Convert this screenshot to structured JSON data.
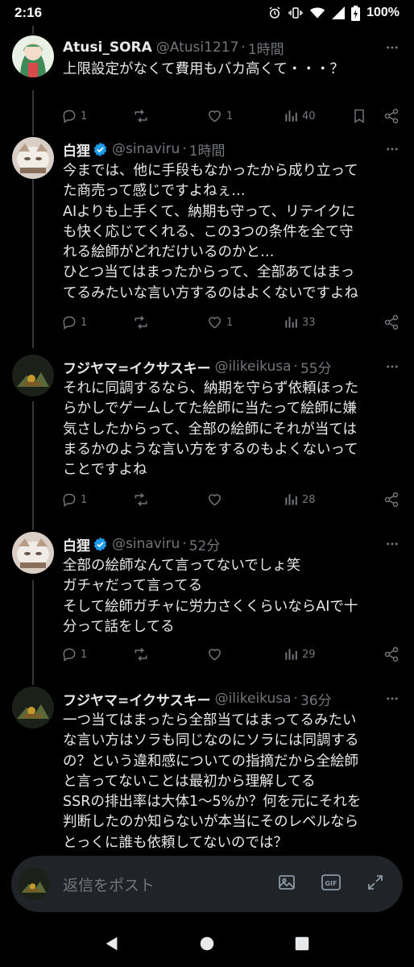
{
  "status_bar": {
    "time": "2:16",
    "battery": "100%"
  },
  "posts": [
    {
      "name": "Atusi_SORA",
      "handle": "@Atusi1217",
      "time": "1時間",
      "verified": false,
      "lines": [
        "上限設定がなくて費用もバカ高くて・・・？"
      ],
      "replies": "1",
      "retweets": "",
      "likes": "1",
      "views": "40"
    },
    {
      "name": "白狸",
      "handle": "@sinaviru",
      "time": "1時間",
      "verified": true,
      "lines": [
        "今までは、他に手段もなかったから成り立って",
        "た商売って感じですよねぇ…",
        "AIよりも上手くて、納期も守って、リテイクに",
        "も快く応じてくれる、この3つの条件を全て守",
        "れる絵師がどれだけいるのかと…",
        "ひとつ当てはまったからって、全部あてはまっ",
        "てるみたいな言い方するのはよくないですよね"
      ],
      "replies": "1",
      "retweets": "",
      "likes": "1",
      "views": "33"
    },
    {
      "name": "フジヤマ=イクサスキー",
      "handle": "@ilikeikusa",
      "time": "55分",
      "verified": false,
      "lines": [
        "それに同調するなら、納期を守らず依頼ほった",
        "らかしでゲームしてた絵師に当たって絵師に嫌",
        "気さしたからって、全部の絵師にそれが当ては",
        "まるかのような言い方をするのもよくないって",
        "ことですよね"
      ],
      "replies": "1",
      "retweets": "",
      "likes": "",
      "views": "28"
    },
    {
      "name": "白狸",
      "handle": "@sinaviru",
      "time": "52分",
      "verified": true,
      "lines": [
        "全部の絵師なんて言ってないでしょ笑",
        "ガチャだって言ってる",
        "そして絵師ガチャに労力さくくらいならAIで十",
        "分って話をしてる"
      ],
      "replies": "1",
      "retweets": "",
      "likes": "",
      "views": "29"
    },
    {
      "name": "フジヤマ=イクサスキー",
      "handle": "@ilikeikusa",
      "time": "36分",
      "verified": false,
      "lines": [
        "一つ当てはまったら全部当てはまってるみたい",
        "な言い方はソラも同じなのにソラには同調する",
        "の？という違和感についての指摘だから全絵師",
        "と言ってないことは最初から理解してる",
        "SSRの排出率は大体1〜5%か？何を元にそれを",
        "判断したのか知らないが本当にそのレベルなら",
        "とっくに誰も依頼してないのでは？"
      ],
      "replies": "",
      "retweets": "",
      "likes": "",
      "views": ""
    }
  ],
  "reply_bar": {
    "placeholder": "返信をポスト",
    "gif_label": "GIF"
  },
  "colors": {
    "background": "#000000",
    "text": "#e7e9ea",
    "muted": "#71767b",
    "verified": "#1d9bf0",
    "divider": "#333639"
  }
}
